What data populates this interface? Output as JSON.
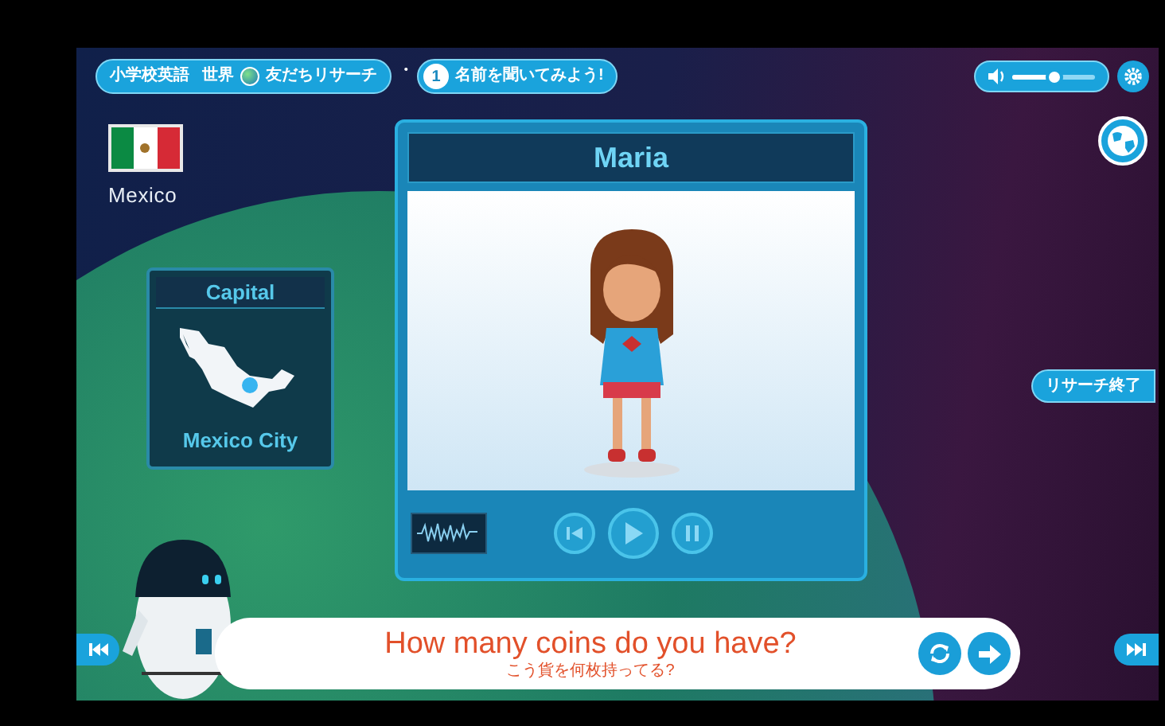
{
  "header": {
    "course": "小学校英語",
    "title_before": "世界",
    "title_after": "友だちリサーチ",
    "separator": "・",
    "step_number": "1",
    "step_title": "名前を聞いてみよう!"
  },
  "volume": {
    "level": 0.5
  },
  "country": {
    "name": "Mexico"
  },
  "capital_card": {
    "heading": "Capital",
    "city": "Mexico City"
  },
  "profile": {
    "name": "Maria"
  },
  "research_end_button": "リサーチ終了",
  "speech": {
    "text": "How many coins do you have?",
    "translation": "こう貨を何枚持ってる?"
  }
}
